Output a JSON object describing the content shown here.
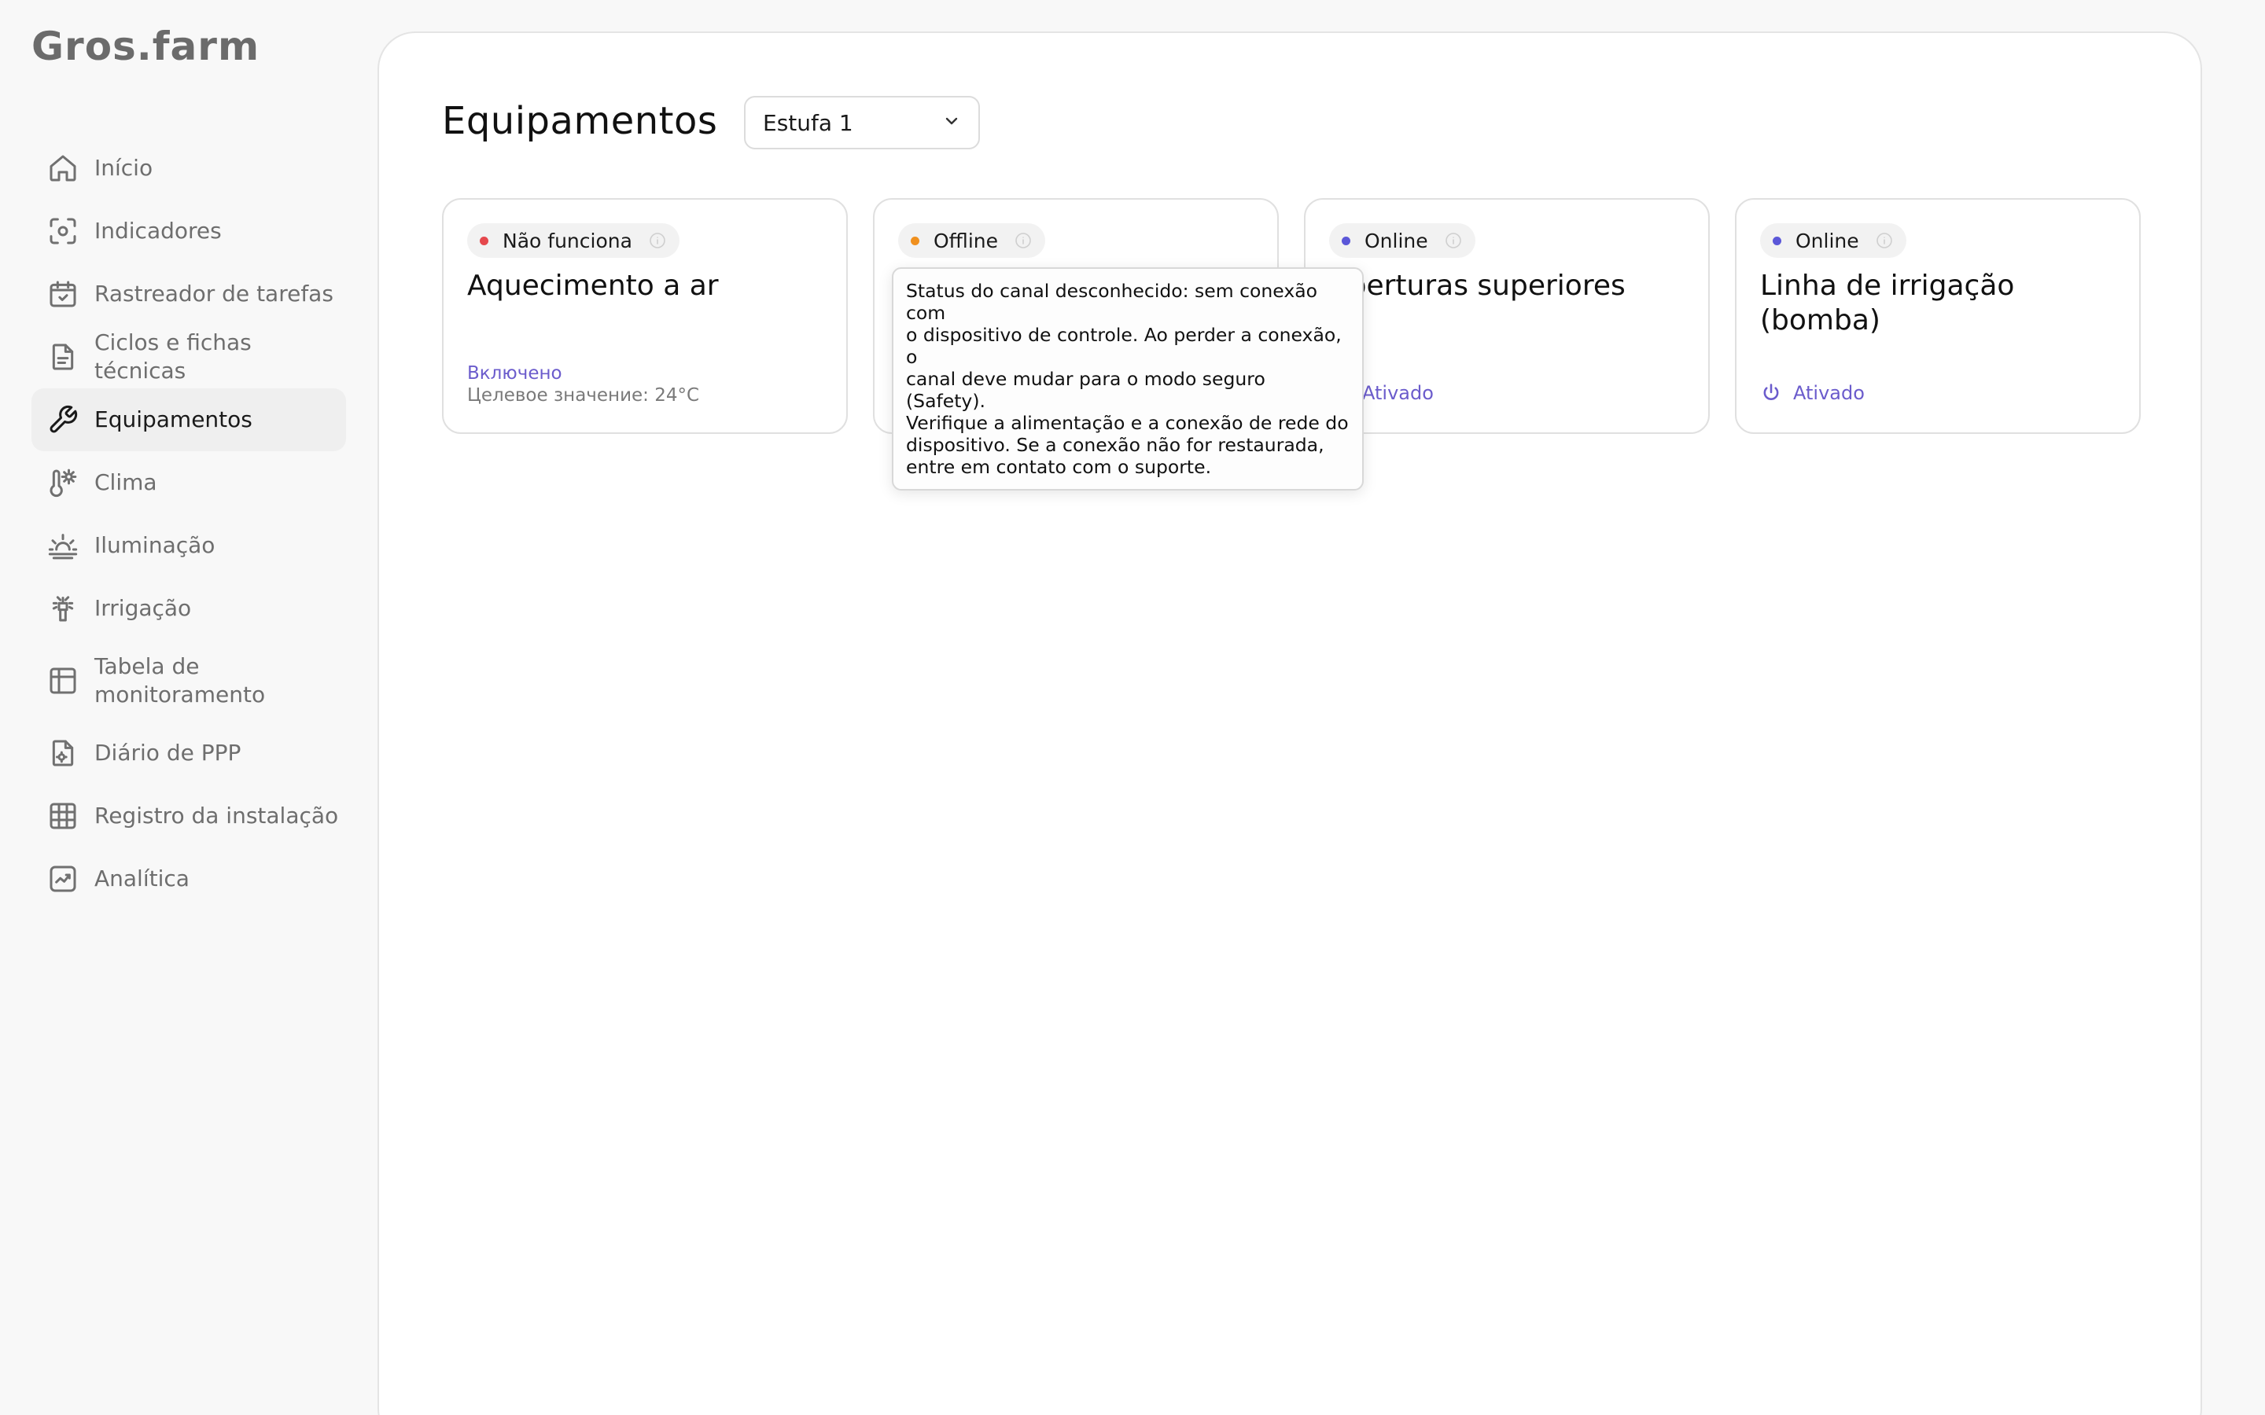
{
  "app": {
    "logo": "Gros.farm"
  },
  "sidebar": {
    "items": [
      {
        "label": "Início",
        "icon": "home-icon",
        "active": false
      },
      {
        "label": "Indicadores",
        "icon": "scan-icon",
        "active": false
      },
      {
        "label": "Rastreador de tarefas",
        "icon": "calendar-check-icon",
        "active": false
      },
      {
        "label": "Ciclos e fichas técnicas",
        "icon": "document-icon",
        "active": false
      },
      {
        "label": "Equipamentos",
        "icon": "wrench-icon",
        "active": true
      },
      {
        "label": "Clima",
        "icon": "thermometer-sun-icon",
        "active": false
      },
      {
        "label": "Iluminação",
        "icon": "sunrise-icon",
        "active": false
      },
      {
        "label": "Irrigação",
        "icon": "sprinkler-icon",
        "active": false
      },
      {
        "label": "Tabela de monitoramento",
        "label_line1": "Tabela de",
        "label_line2": "monitoramento",
        "icon": "table-icon",
        "active": false
      },
      {
        "label": "Diário de PPP",
        "icon": "document-gear-icon",
        "active": false
      },
      {
        "label": "Registro da instalação",
        "icon": "grid-icon",
        "active": false
      },
      {
        "label": "Analítica",
        "icon": "chart-icon",
        "active": false
      }
    ]
  },
  "main": {
    "title": "Equipamentos",
    "greenhouse_select": {
      "value": "Estufa 1"
    },
    "cards": [
      {
        "status": "Não funciona",
        "status_color": "#e5484d",
        "title": "Aquecimento a ar",
        "state_text": "Включено",
        "sub_text": "Целевое значение: 24°C"
      },
      {
        "status": "Offline",
        "status_color": "#f0901e",
        "title": ""
      },
      {
        "status": "Online",
        "status_color": "#5b57d8",
        "title": "Aberturas superiores",
        "title_visible": "berturas superiores",
        "power_label": "Ativado"
      },
      {
        "status": "Online",
        "status_color": "#5b57d8",
        "title": "Linha de irrigação (bomba)",
        "power_label": "Ativado"
      }
    ],
    "tooltip": {
      "text": "Status do canal desconhecido: sem conexão com o dispositivo de controle. Ao perder a conexão, o canal deve mudar para o modo seguro (Safety). Verifique a alimentação e a conexão de rede do dispositivo. Se a conexão não for restaurada, entre em contato com o suporte.",
      "lines": [
        "Status do canal desconhecido: sem conexão com",
        "o dispositivo de controle. Ao perder a conexão, o",
        "canal deve mudar para o modo seguro (Safety).",
        "Verifique a alimentação e a conexão de rede do",
        "dispositivo. Se a conexão não for restaurada,",
        "entre em contato com o suporte."
      ]
    }
  },
  "colors": {
    "accent": "#6b5ccc",
    "error": "#e5484d",
    "warning": "#f0901e",
    "online": "#5b57d8"
  }
}
